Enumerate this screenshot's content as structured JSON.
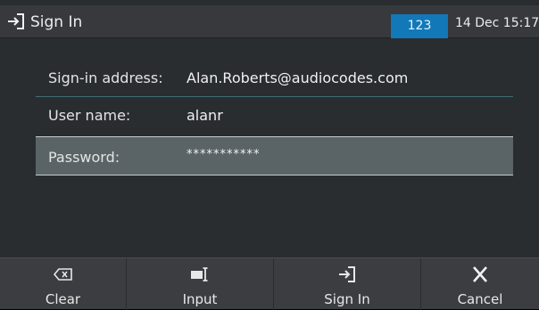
{
  "header": {
    "icon": "sign-in-icon",
    "title": "Sign In",
    "input_mode": "123",
    "datetime": "14 Dec 15:17"
  },
  "form": {
    "address": {
      "label": "Sign-in address:",
      "value": "Alan.Roberts@audiocodes.com"
    },
    "username": {
      "label": "User name:",
      "value": "alanr"
    },
    "password": {
      "label": "Password:",
      "value": "***********"
    }
  },
  "softkeys": [
    {
      "label": "Clear",
      "icon": "backspace-icon"
    },
    {
      "label": "Input",
      "icon": "keyboard-input-icon"
    },
    {
      "label": "Sign In",
      "icon": "sign-in-icon"
    },
    {
      "label": "Cancel",
      "icon": "close-icon"
    }
  ],
  "colors": {
    "input_mode_bg": "#1278b8",
    "selected_row_bg": "#5a6466",
    "background": "#2a2d30"
  }
}
